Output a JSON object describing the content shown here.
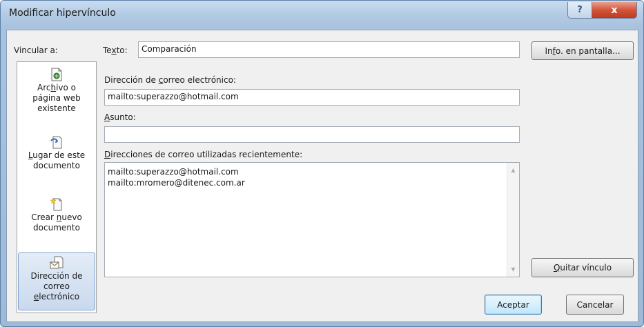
{
  "window": {
    "title": "Modificar hipervínculo",
    "help_glyph": "?",
    "close_glyph": "x"
  },
  "link_to": {
    "label": "Vincular a:",
    "items": [
      {
        "pre": "Arc",
        "acc": "h",
        "post": "ivo o",
        "line2": "página web",
        "line3": "existente",
        "icon": "existing-file-icon"
      },
      {
        "pre": "",
        "acc": "L",
        "post": "ugar de este",
        "line2": "documento",
        "icon": "place-in-document-icon"
      },
      {
        "pre": "Crear ",
        "acc": "n",
        "post": "uevo",
        "line2": "documento",
        "icon": "create-new-document-icon"
      },
      {
        "line1": "Dirección de",
        "line2": "correo",
        "pre": "",
        "acc": "e",
        "post": "lectrónico",
        "icon": "email-address-icon",
        "selected": true
      }
    ]
  },
  "text_field": {
    "label_pre": "Te",
    "label_acc": "x",
    "label_post": "to:",
    "value": "Comparación"
  },
  "screen_tip_button": {
    "pre": "In",
    "acc": "f",
    "post": "o. en pantalla..."
  },
  "email_address": {
    "label_pre": "Dirección de ",
    "label_acc": "c",
    "label_post": "orreo electrónico:",
    "value": "mailto:superazzo@hotmail.com"
  },
  "subject": {
    "label_pre": "",
    "label_acc": "A",
    "label_post": "sunto:",
    "value": ""
  },
  "recent": {
    "label_pre": "",
    "label_acc": "D",
    "label_post": "irecciones de correo utilizadas recientemente:",
    "items": [
      "mailto:superazzo@hotmail.com",
      "mailto:mromero@ditenec.com.ar"
    ]
  },
  "remove_link_button": {
    "pre": "",
    "acc": "Q",
    "post": "uitar vínculo"
  },
  "ok_button": "Aceptar",
  "cancel_button": "Cancelar",
  "colors": {
    "title_bar": "#b3cbe5",
    "close_button": "#c0391e",
    "selection": "#c9d9ee",
    "default_button_border": "#3c7fb1"
  }
}
